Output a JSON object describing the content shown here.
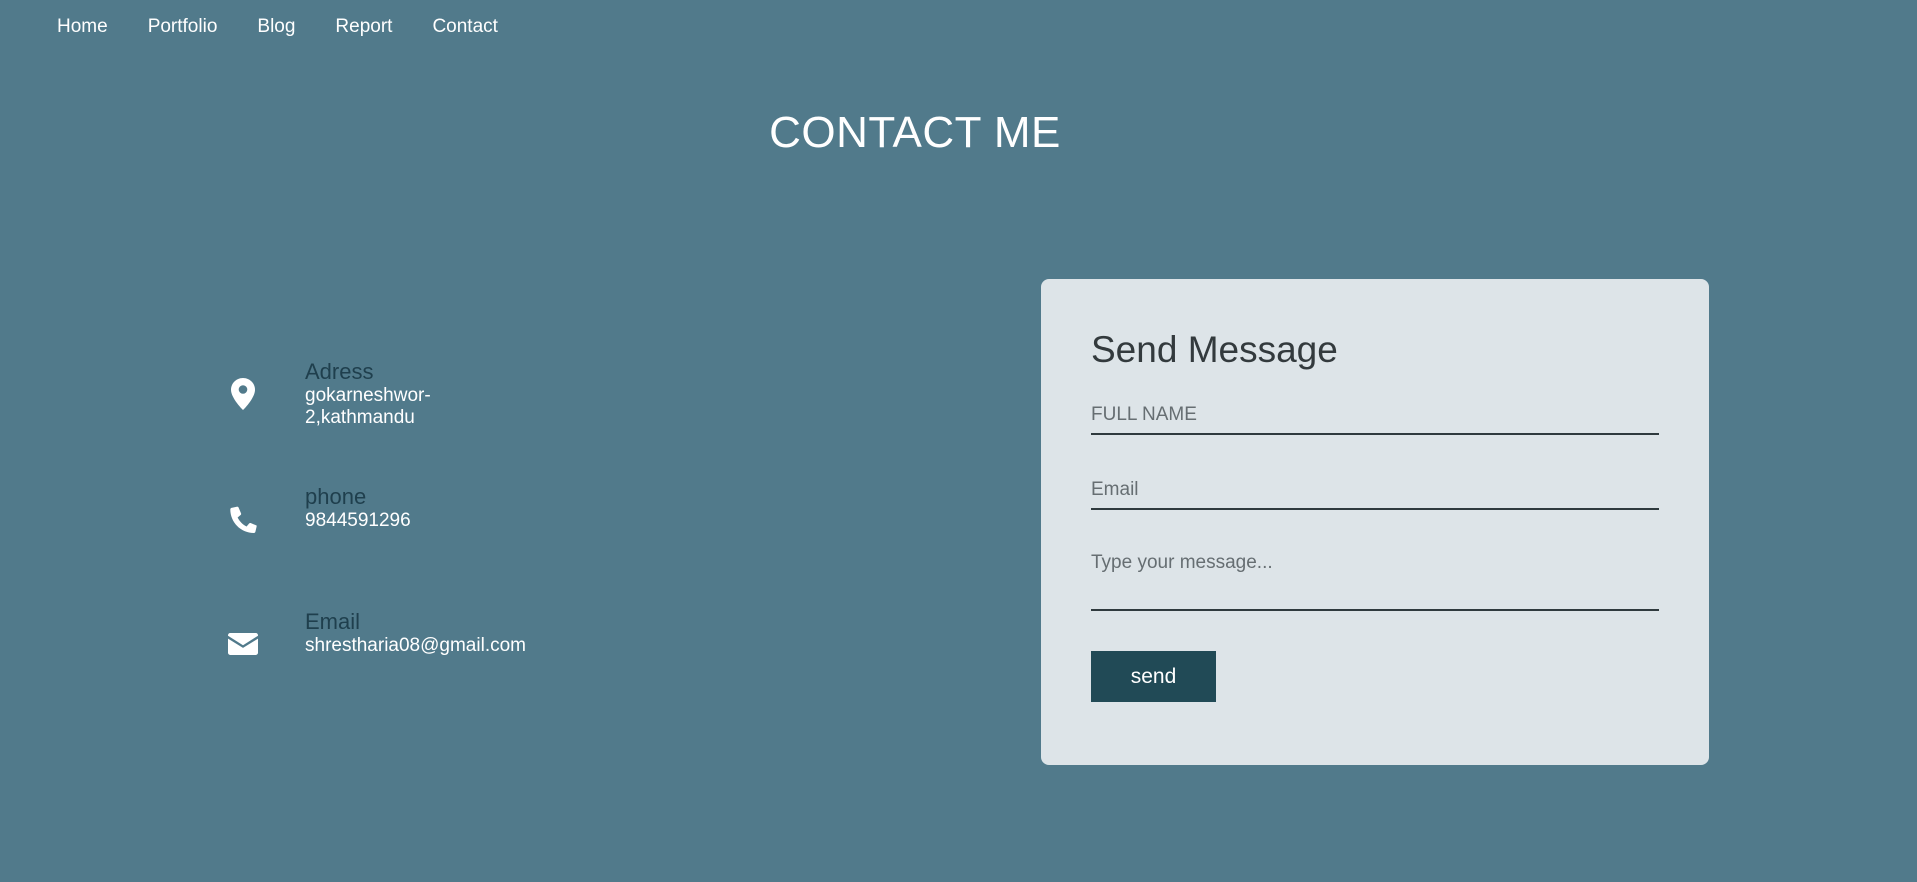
{
  "nav": {
    "items": [
      {
        "label": "Home"
      },
      {
        "label": "Portfolio"
      },
      {
        "label": "Blog"
      },
      {
        "label": "Report"
      },
      {
        "label": "Contact"
      }
    ]
  },
  "page_title": "CONTACT ME",
  "info": {
    "address": {
      "label": "Adress",
      "value": "gokarneshwor-2,kathmandu",
      "icon": "map-marker-icon"
    },
    "phone": {
      "label": "phone",
      "value": "9844591296",
      "icon": "phone-icon"
    },
    "email": {
      "label": "Email",
      "value": "shrestharia08@gmail.com",
      "icon": "envelope-icon"
    }
  },
  "form": {
    "title": "Send Message",
    "name_placeholder": "FULL NAME",
    "email_placeholder": "Email",
    "message_placeholder": "Type your message...",
    "send_label": "send"
  },
  "colors": {
    "background": "#517a8b",
    "card": "#dde4e8",
    "button": "#214a56",
    "label": "#1f3f4d"
  }
}
